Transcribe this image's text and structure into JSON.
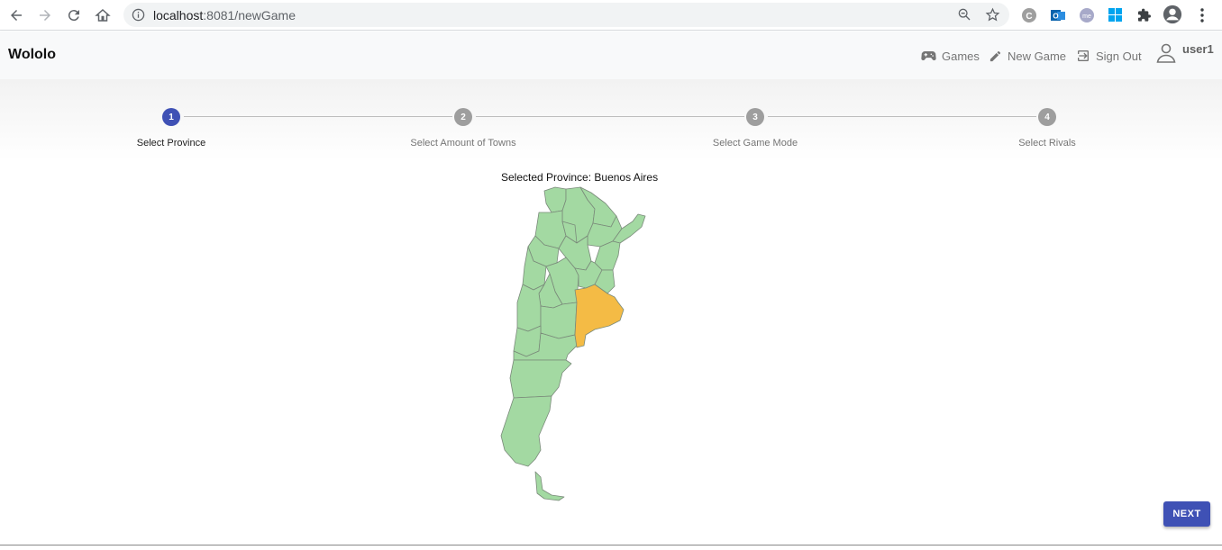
{
  "browser": {
    "url_host": "localhost",
    "url_rest": ":8081/newGame"
  },
  "app": {
    "brand": "Wololo",
    "nav": {
      "games": "Games",
      "new_game": "New Game",
      "sign_out": "Sign Out",
      "user": "user1"
    }
  },
  "stepper": {
    "steps": [
      {
        "number": "1",
        "label": "Select Province"
      },
      {
        "number": "2",
        "label": "Select Amount of Towns"
      },
      {
        "number": "3",
        "label": "Select Game Mode"
      },
      {
        "number": "4",
        "label": "Select Rivals"
      }
    ],
    "active_step": 1
  },
  "map": {
    "selected_text": "Selected Province: Buenos Aires",
    "selected_color": "#f4bb45",
    "default_color": "#a3d9a2"
  },
  "actions": {
    "next": "NEXT"
  },
  "colors": {
    "primary": "#3f51b5",
    "inactive_step": "#9e9e9e"
  }
}
